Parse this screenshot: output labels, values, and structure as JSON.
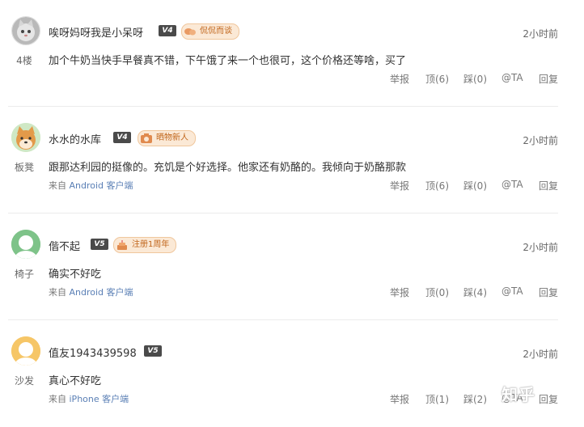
{
  "comments": [
    {
      "username": "唉呀妈呀我是小呆呀",
      "level": "V4",
      "medal": "侃侃而谈",
      "time": "2小时前",
      "floor": "4楼",
      "content": "加个牛奶当快手早餐真不错，下午饿了来一个也很可，这个价格还等啥，买了",
      "source_prefix": "",
      "source_client": "",
      "source_suffix": "",
      "actions": {
        "report": "举报",
        "up": "顶(6)",
        "down": "踩(0)",
        "at": "@TA",
        "reply": "回复"
      }
    },
    {
      "username": "水水的水库",
      "level": "V4",
      "medal": "晒物新人",
      "time": "2小时前",
      "floor": "板凳",
      "content": "跟那达利园的挺像的。充饥是个好选择。他家还有奶酪的。我倾向于奶酪那款",
      "source_prefix": "来自 ",
      "source_client": "Android",
      "source_suffix": " 客户端",
      "actions": {
        "report": "举报",
        "up": "顶(6)",
        "down": "踩(0)",
        "at": "@TA",
        "reply": "回复"
      }
    },
    {
      "username": "偕不起",
      "level": "V5",
      "medal": "注册1周年",
      "time": "2小时前",
      "floor": "椅子",
      "content": "确实不好吃",
      "source_prefix": "来自 ",
      "source_client": "Android",
      "source_suffix": " 客户端",
      "actions": {
        "report": "举报",
        "up": "顶(0)",
        "down": "踩(4)",
        "at": "@TA",
        "reply": "回复"
      }
    },
    {
      "username": "值友1943439598",
      "level": "V5",
      "medal": "",
      "time": "2小时前",
      "floor": "沙发",
      "content": "真心不好吃",
      "source_prefix": "来自 ",
      "source_client": "iPhone",
      "source_suffix": " 客户端",
      "actions": {
        "report": "举报",
        "up": "顶(1)",
        "down": "踩(2)",
        "at": "@TA",
        "reply": "回复"
      }
    }
  ],
  "watermark": "知乎",
  "colors": {
    "accent_red": "#e26c6c",
    "client_blue": "#5a7fb5",
    "level_badge": "#4a4a4a",
    "avatar_green": "#7ec389",
    "avatar_yellow": "#f6c667",
    "medal_bg": "#fbe9d6"
  },
  "icons": {
    "avatar_1": "cat-avatar-icon",
    "avatar_2": "shiba-dog-avatar-icon",
    "avatar_3": "default-user-avatar-icon",
    "avatar_4": "default-user-avatar-icon",
    "medal_1": "chat-bubbles-icon",
    "medal_2": "camera-icon",
    "medal_3": "cake-icon"
  }
}
